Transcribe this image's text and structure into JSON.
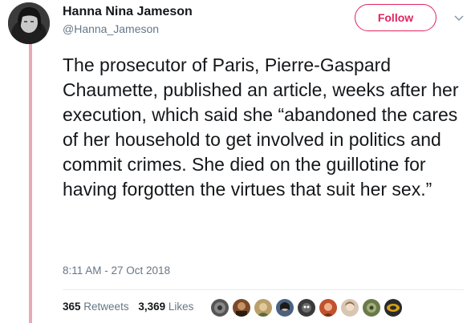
{
  "author": {
    "name": "Hanna Nina Jameson",
    "handle": "@Hanna_Jameson"
  },
  "actions": {
    "follow_label": "Follow",
    "menu_icon": "chevron-down-icon"
  },
  "tweet": {
    "text": "The prosecutor of Paris, Pierre-Gaspard Chaumette, published an article, weeks after her execution, which said she “abandoned the cares of her household to get involved in politics and commit crimes. She died on the guillotine for having forgotten the virtues that suit her sex.”",
    "timestamp": "8:11 AM - 27 Oct 2018"
  },
  "stats": {
    "retweets_count": "365",
    "retweets_label": "Retweets",
    "likes_count": "3,369",
    "likes_label": "Likes"
  },
  "colors": {
    "accent": "#e0245e",
    "thread_line": "#e6aab8",
    "secondary_text": "#657786"
  },
  "liker_avatars": [
    "avatar-1",
    "avatar-2",
    "avatar-3",
    "avatar-4",
    "avatar-5",
    "avatar-6",
    "avatar-7",
    "avatar-8",
    "avatar-9"
  ]
}
